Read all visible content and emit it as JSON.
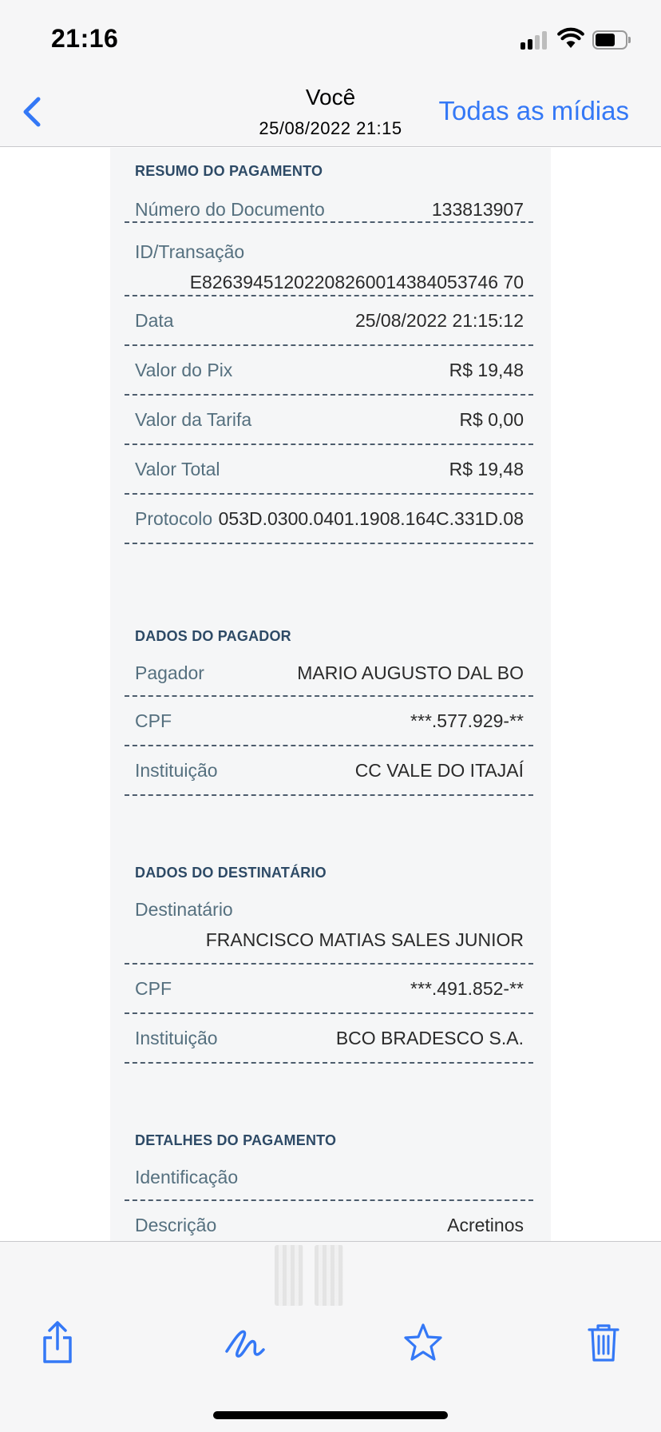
{
  "status_bar": {
    "time": "21:16"
  },
  "nav": {
    "title": "Você",
    "subtitle": "25/08/2022 21:15",
    "action_label": "Todas as mídias"
  },
  "receipt": {
    "resumo": {
      "title": "RESUMO DO PAGAMENTO",
      "numero_label": "Número do Documento",
      "numero_value": "133813907",
      "id_label": "ID/Transação",
      "id_value": "E82639451202208260014384053746 70",
      "data_label": "Data",
      "data_value": "25/08/2022 21:15:12",
      "valor_pix_label": "Valor do Pix",
      "valor_pix_value": "R$ 19,48",
      "tarifa_label": "Valor da Tarifa",
      "tarifa_value": "R$ 0,00",
      "total_label": "Valor Total",
      "total_value": "R$ 19,48",
      "protocolo_label": "Protocolo",
      "protocolo_value": "053D.0300.0401.1908.164C.331D.08"
    },
    "pagador": {
      "title": "DADOS DO PAGADOR",
      "pagador_label": "Pagador",
      "pagador_value": "MARIO AUGUSTO DAL BO",
      "cpf_label": "CPF",
      "cpf_value": "***.577.929-**",
      "inst_label": "Instituição",
      "inst_value": "CC VALE DO ITAJAÍ"
    },
    "destinatario": {
      "title": "DADOS DO DESTINATÁRIO",
      "dest_label": "Destinatário",
      "dest_value": "FRANCISCO MATIAS SALES JUNIOR",
      "cpf_label": "CPF",
      "cpf_value": "***.491.852-**",
      "inst_label": "Instituição",
      "inst_value": "BCO BRADESCO S.A."
    },
    "detalhes": {
      "title": "DETALHES DO PAGAMENTO",
      "ident_label": "Identificação",
      "desc_label": "Descrição",
      "desc_value": "Acretinos"
    }
  },
  "toolbar": {
    "icons": [
      "share-icon",
      "markup-icon",
      "star-icon",
      "trash-icon"
    ]
  },
  "colors": {
    "accent": "#3478f6",
    "section_title": "#2d4a66",
    "label": "#55707f"
  }
}
